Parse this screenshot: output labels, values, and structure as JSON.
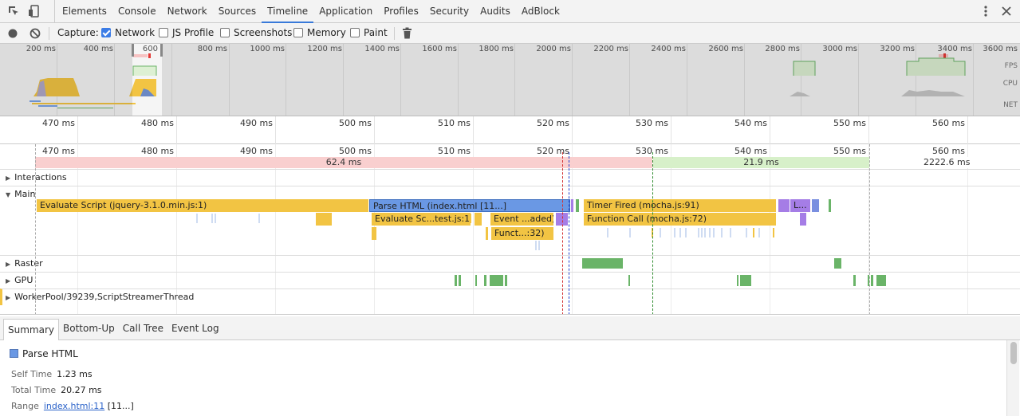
{
  "tabbar": {
    "tabs": [
      "Elements",
      "Console",
      "Network",
      "Sources",
      "Timeline",
      "Application",
      "Profiles",
      "Security",
      "Audits",
      "AdBlock"
    ],
    "active": "Timeline",
    "icons": [
      "inspect-element-icon",
      "device-mode-icon",
      "more-vertical-icon",
      "close-icon"
    ]
  },
  "toolbar": {
    "record_icon": "record-icon",
    "clear_icon": "clear-icon",
    "capture_label": "Capture:",
    "options": [
      {
        "label": "Network",
        "checked": true
      },
      {
        "label": "JS Profile",
        "checked": false
      },
      {
        "label": "Screenshots",
        "checked": false
      },
      {
        "label": "Memory",
        "checked": false
      },
      {
        "label": "Paint",
        "checked": false
      }
    ],
    "trash_icon": "trash-icon"
  },
  "overview": {
    "ticks": [
      "200 ms",
      "400 ms",
      "600",
      "800 ms",
      "1000 ms",
      "1200 ms",
      "1400 ms",
      "1600 ms",
      "1800 ms",
      "2000 ms",
      "2200 ms",
      "2400 ms",
      "2600 ms",
      "2800 ms",
      "3000 ms",
      "3200 ms",
      "3400 ms",
      "3600 ms"
    ],
    "lanes": [
      "FPS",
      "CPU",
      "NET"
    ]
  },
  "ruler": {
    "ticks": [
      "470 ms",
      "480 ms",
      "490 ms",
      "500 ms",
      "510 ms",
      "520 ms",
      "530 ms",
      "540 ms",
      "550 ms",
      "560 ms"
    ]
  },
  "frames": [
    {
      "label": "62.4 ms",
      "color": "#f9cfcf"
    },
    {
      "label": "21.9 ms",
      "color": "#d7f0c9"
    },
    {
      "label": "2222.6 ms",
      "color": "#ffffff"
    }
  ],
  "tracks": {
    "interactions": "Interactions",
    "main": "Main",
    "raster": "Raster",
    "gpu": "GPU",
    "worker": "WorkerPool/39239,ScriptStreamerThread"
  },
  "main_events": {
    "evaluate_script": "Evaluate Script (jquery-3.1.0.min.js:1)",
    "parse_html": "Parse HTML (index.html [11...]",
    "timer_fired": "Timer Fired (mocha.js:91)",
    "l": "L...",
    "evaluate_sc": "Evaluate Sc...test.js:1)",
    "event_loaded": "Event ...aded)",
    "function_call": "Function Call (mocha.js:72)",
    "funct": "Funct...:32)"
  },
  "colors": {
    "scripting": "#f2c443",
    "loading": "#6a98e4",
    "rendering": "#a57de6",
    "painting": "#6ab468",
    "frame_long": "#f9cfcf",
    "frame_ok": "#d7f0c9",
    "accent": "#3879d9"
  },
  "details_tabs": [
    "Summary",
    "Bottom-Up",
    "Call Tree",
    "Event Log"
  ],
  "summary": {
    "title": "Parse HTML",
    "self_time_label": "Self Time",
    "self_time": "1.23 ms",
    "total_time_label": "Total Time",
    "total_time": "20.27 ms",
    "range_label": "Range",
    "range_link": "index.html:11",
    "range_extra": "[11...]"
  }
}
